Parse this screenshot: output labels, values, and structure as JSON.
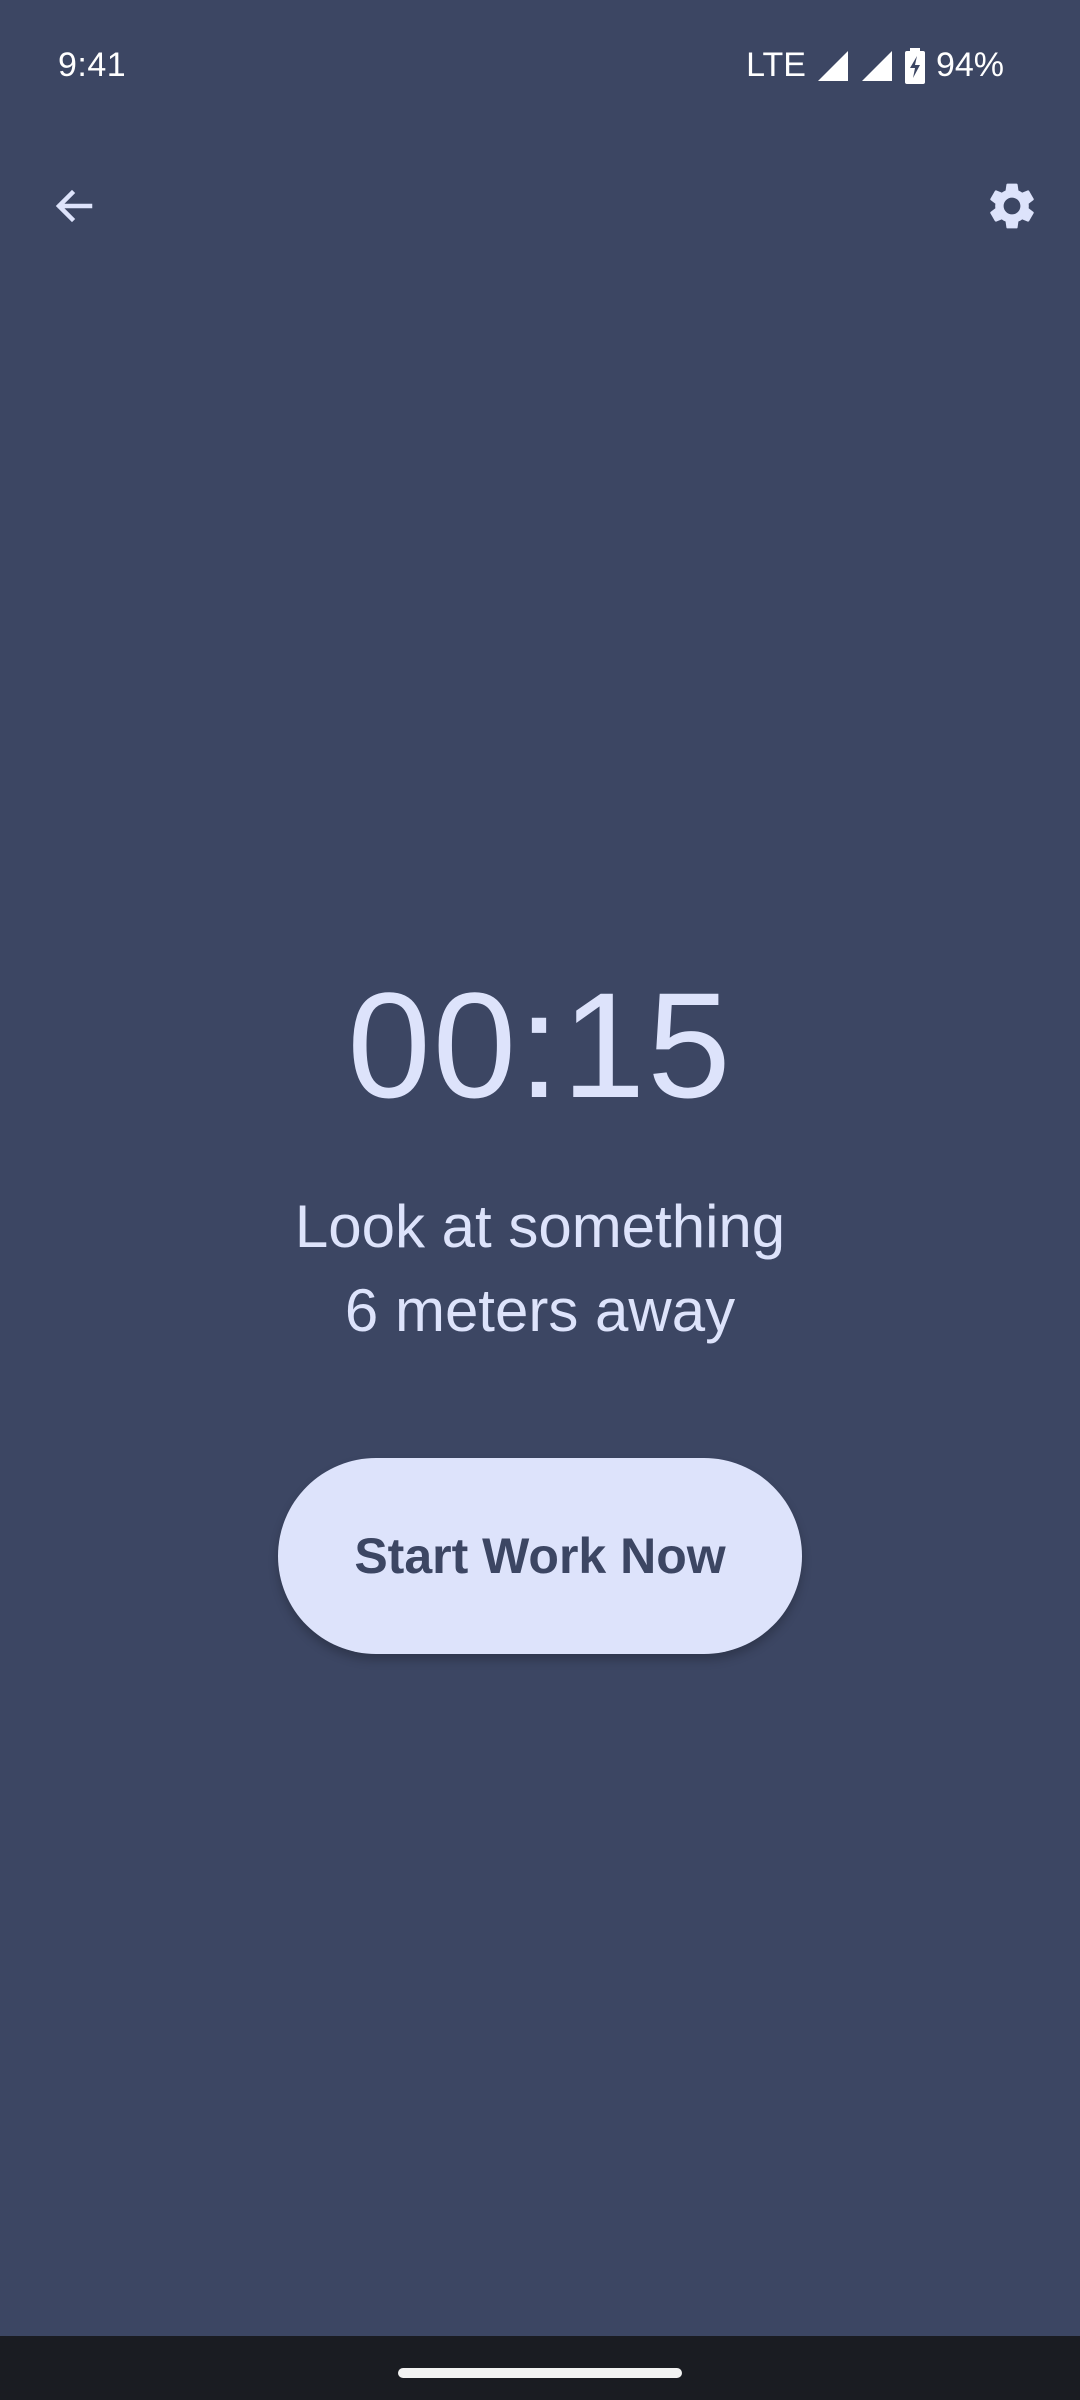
{
  "status_bar": {
    "time": "9:41",
    "network": "LTE",
    "battery": "94%"
  },
  "top_bar": {
    "back_icon": "arrow-left-icon",
    "settings_icon": "gear-icon"
  },
  "timer": {
    "value": "00:15"
  },
  "instruction": {
    "line1": "Look at something",
    "line2": "6 meters away"
  },
  "actions": {
    "start_label": "Start Work Now"
  },
  "colors": {
    "background": "#3c4663",
    "foreground": "#dde3fb",
    "button_fill": "#dde3fb",
    "button_text": "#3c4663",
    "nav_bar": "#1a1c22"
  }
}
